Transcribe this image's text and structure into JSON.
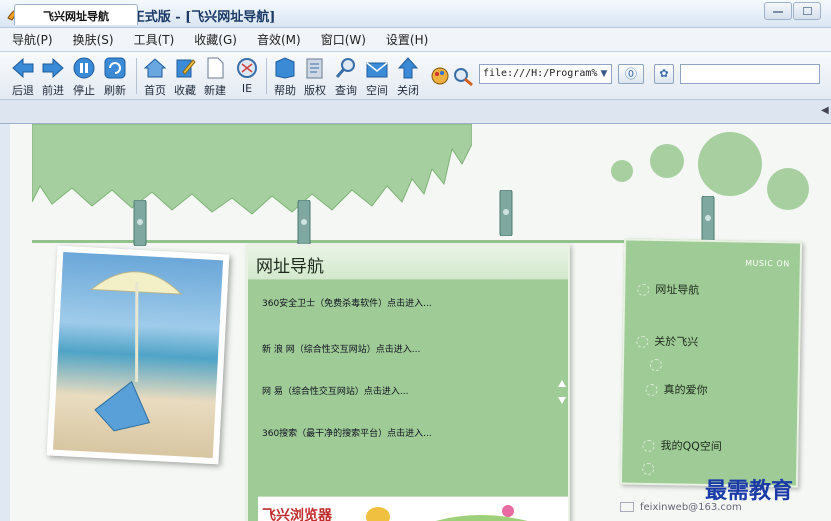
{
  "window": {
    "title": "飞兴浏览器 2013正式版 - [飞兴网址导航]"
  },
  "menu": [
    "导航(P)",
    "换肤(S)",
    "工具(T)",
    "收藏(G)",
    "音效(M)",
    "窗口(W)",
    "设置(H)"
  ],
  "toolbar": {
    "buttons": [
      {
        "label": "后退",
        "icon": "back-arrow-icon"
      },
      {
        "label": "前进",
        "icon": "forward-arrow-icon"
      },
      {
        "label": "停止",
        "icon": "stop-icon"
      },
      {
        "label": "刷新",
        "icon": "refresh-icon"
      },
      {
        "label": "首页",
        "icon": "home-icon"
      },
      {
        "label": "收藏",
        "icon": "bookmark-icon"
      },
      {
        "label": "新建",
        "icon": "new-page-icon"
      },
      {
        "label": "IE",
        "icon": "ie-icon"
      },
      {
        "label": "帮助",
        "icon": "help-icon"
      },
      {
        "label": "版权",
        "icon": "copyright-icon"
      },
      {
        "label": "查询",
        "icon": "search-icon"
      },
      {
        "label": "空间",
        "icon": "mail-icon"
      },
      {
        "label": "关闭",
        "icon": "close-up-icon"
      }
    ],
    "address": "file:///H:/Program%"
  },
  "tab": {
    "label": "飞兴网址导航"
  },
  "content": {
    "nav_title": "网址导航",
    "links": [
      "360安全卫士（免费杀毒软件）点击进入...",
      "新 浪 网（综合性交互网站）点击进入...",
      "网   易（综合性交互网站）点击进入...",
      "360搜索（最干净的搜索平台）点击进入..."
    ],
    "banner": "飞兴浏览器",
    "side_badge": "MUSIC ON",
    "side_items": [
      "网址导航",
      "关於飞兴",
      "真的爱你",
      "我的QQ空间"
    ],
    "email": "feixinweb@163.com"
  },
  "watermark": "最需教育",
  "colors": {
    "accent_green": "#9fcb96",
    "window_blue": "#1a3a66"
  }
}
